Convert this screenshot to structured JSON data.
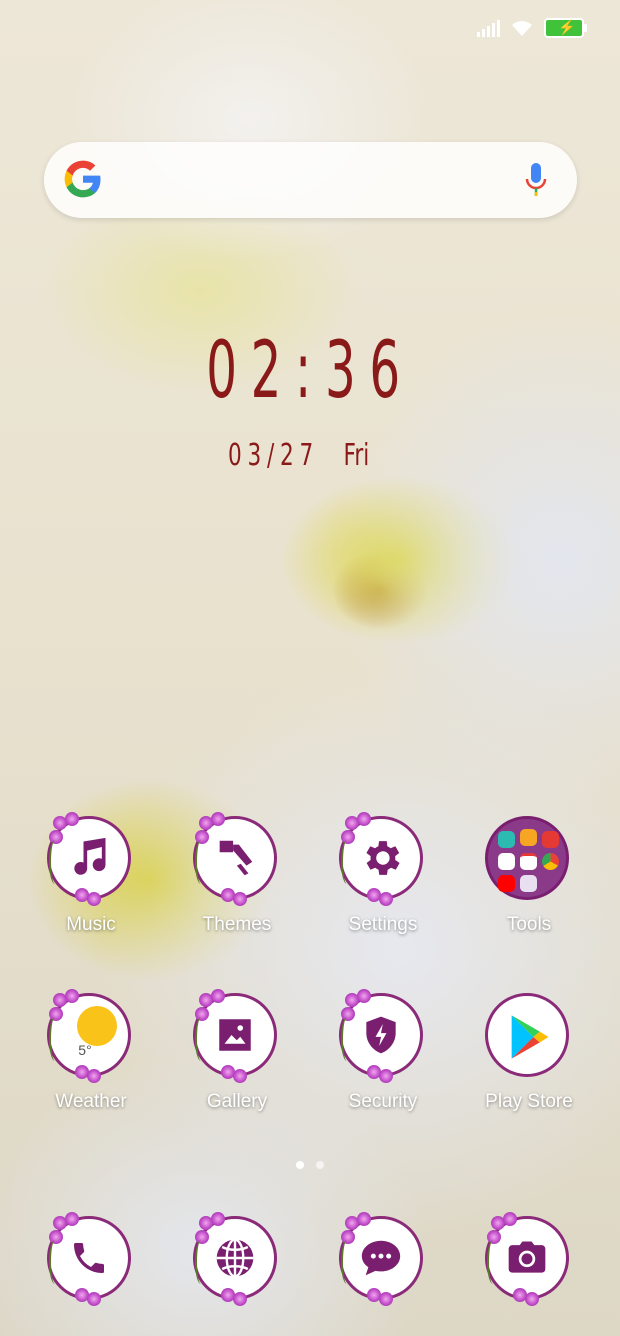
{
  "status_bar": {
    "icons": [
      "signal-icon",
      "wifi-icon",
      "battery-charging-icon"
    ],
    "battery_color": "#41c23b"
  },
  "search_bar": {
    "icons": [
      "google-g-icon",
      "mic-icon"
    ]
  },
  "clock": {
    "time": "02:36",
    "date": "03/27",
    "weekday": "Fri",
    "color": "#8a1a1a"
  },
  "apps": {
    "music": "Music",
    "themes": "Themes",
    "settings": "Settings",
    "tools": "Tools",
    "weather": "Weather",
    "weather_temp": "5°",
    "gallery": "Gallery",
    "security": "Security",
    "play_store": "Play Store"
  },
  "dock": [
    "phone-icon",
    "browser-icon",
    "messages-icon",
    "camera-icon"
  ],
  "page_indicator": {
    "pages": 2,
    "current": 1
  },
  "theme_colors": {
    "icon_purple": "#8a2a78",
    "flower": "#c04bc8"
  }
}
